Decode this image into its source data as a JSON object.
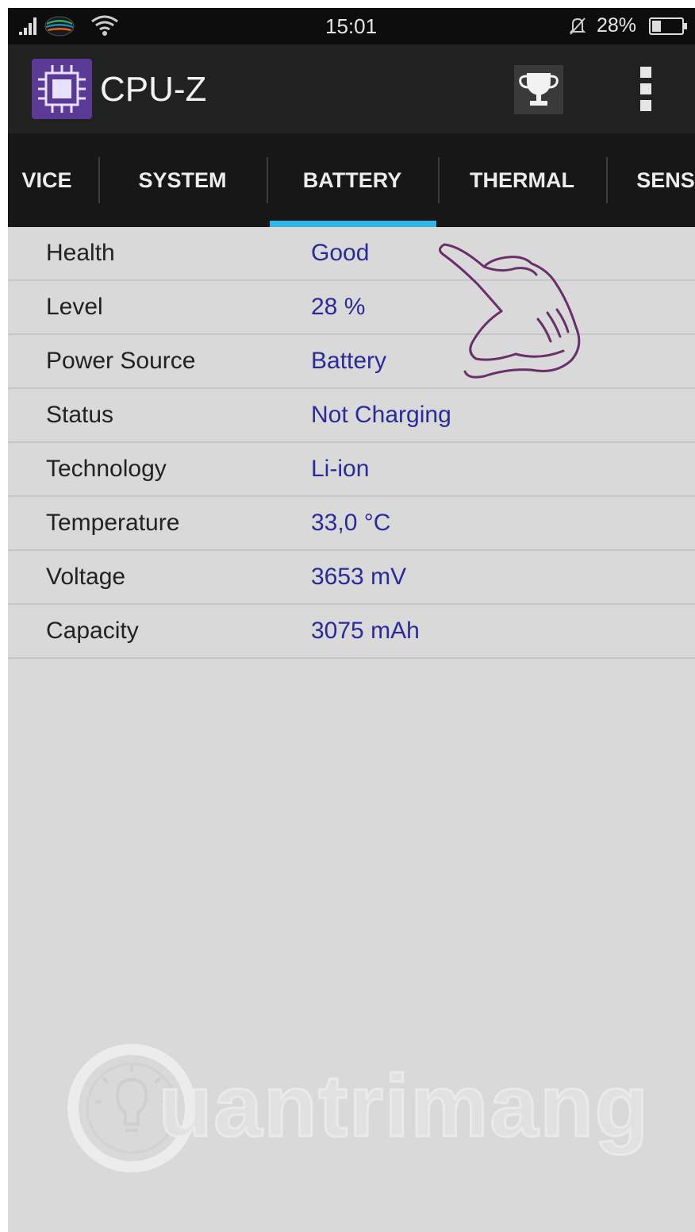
{
  "status_bar": {
    "time": "15:01",
    "battery_percent": "28%",
    "icons": [
      "signal-icon",
      "carrier-icon",
      "wifi-icon",
      "alarm-off-icon",
      "battery-icon"
    ]
  },
  "app_bar": {
    "title": "CPU-Z",
    "icons": [
      "cpu-logo-icon",
      "trophy-icon",
      "overflow-menu-icon"
    ]
  },
  "tabs": [
    {
      "label": "VICE"
    },
    {
      "label": "SYSTEM"
    },
    {
      "label": "BATTERY",
      "selected": true
    },
    {
      "label": "THERMAL"
    },
    {
      "label": "SENS"
    }
  ],
  "battery_info": [
    {
      "label": "Health",
      "value": "Good"
    },
    {
      "label": "Level",
      "value": "28 %"
    },
    {
      "label": "Power Source",
      "value": "Battery"
    },
    {
      "label": "Status",
      "value": "Not Charging"
    },
    {
      "label": "Technology",
      "value": "Li-ion"
    },
    {
      "label": "Temperature",
      "value": "33,0 °C"
    },
    {
      "label": "Voltage",
      "value": "3653 mV"
    },
    {
      "label": "Capacity",
      "value": "3075 mAh"
    }
  ],
  "watermark": {
    "text": "uantrimang"
  },
  "colors": {
    "tab_indicator": "#33b5e5",
    "value_text": "#2a2a9a",
    "app_logo": "#5b3a96",
    "annotation": "#6a2f6a"
  }
}
